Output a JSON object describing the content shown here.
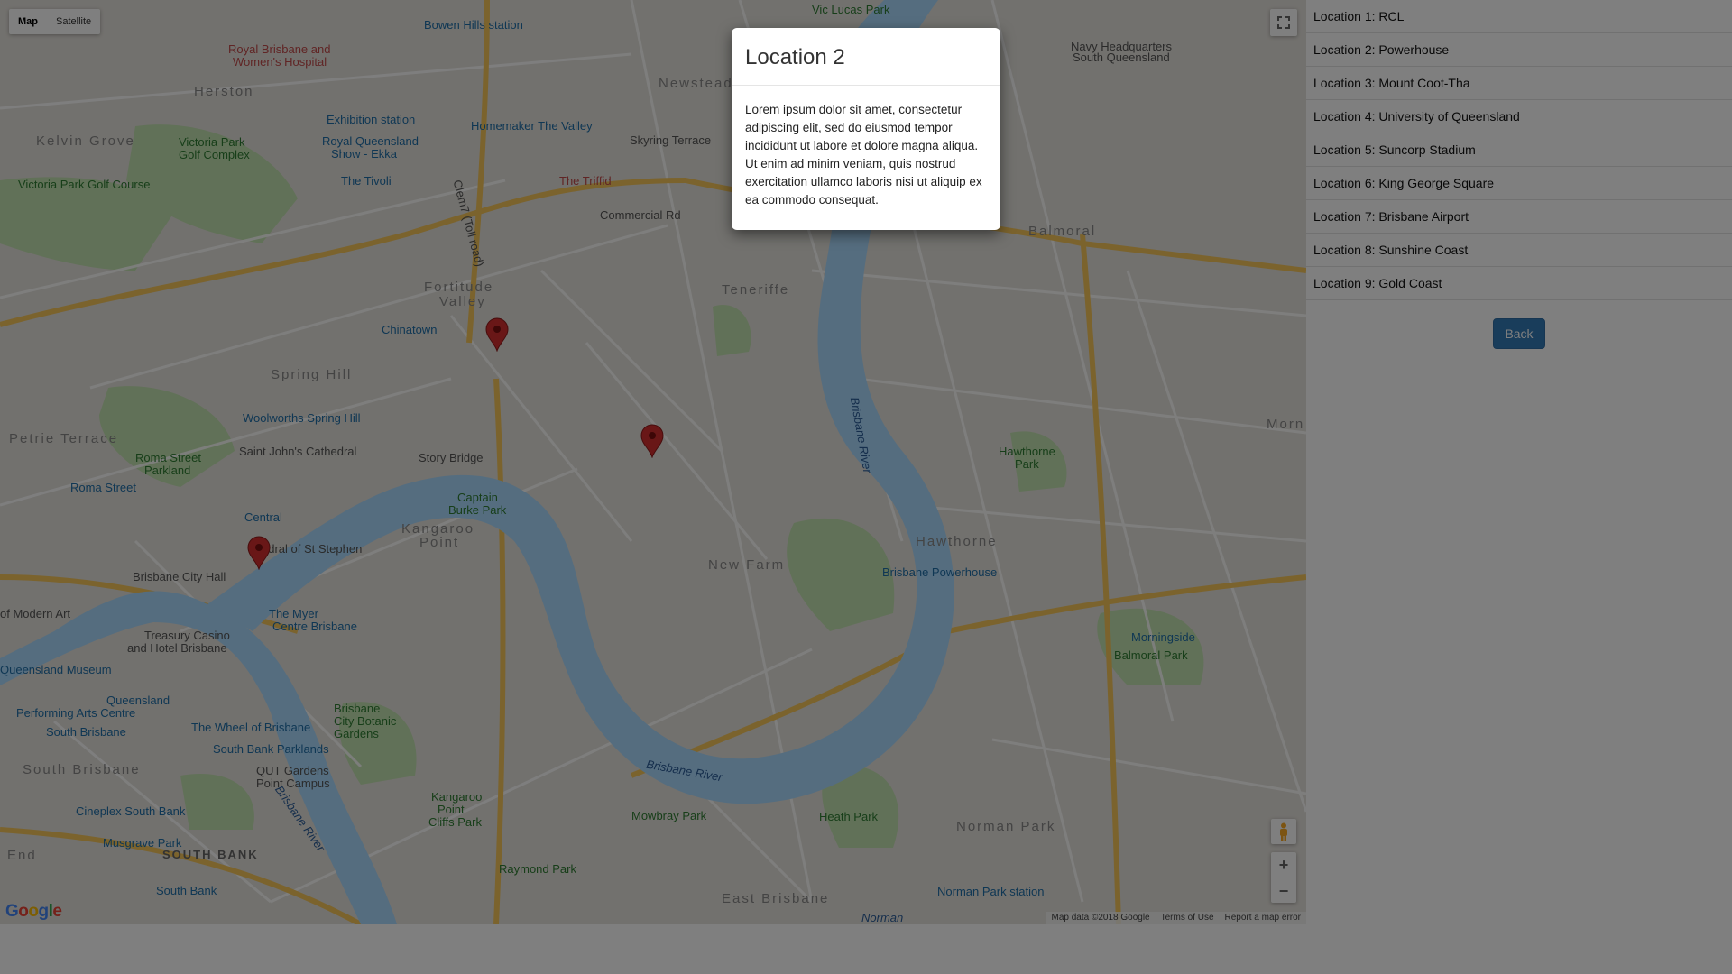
{
  "map": {
    "type_controls": [
      "Map",
      "Satellite"
    ],
    "active_type": "Map",
    "labels": {
      "districts": [
        "Herston",
        "Kelvin Grove",
        "Spring Hill",
        "Fortitude Valley",
        "Newstead",
        "Teneriffe",
        "New Farm",
        "Kangaroo Point",
        "South Brisbane",
        "SOUTH BANK",
        "East Brisbane",
        "Norman Park",
        "Hawthorne",
        "Balmoral",
        "Petrie Terrace",
        "Morn",
        "End"
      ],
      "parks": [
        "Victoria Park Golf Complex",
        "Victoria Park Golf Course",
        "Roma Street Parkland",
        "Captain Burke Park",
        "Brisbane City Botanic Gardens",
        "Kangaroo Point Cliffs Park",
        "Mowbray Park",
        "Raymond Park",
        "Heath Park",
        "Hawthorne Park",
        "Balmoral Park",
        "Vic Lucas Park"
      ],
      "pois": [
        "Bowen Hills station",
        "Royal Brisbane and Women's Hospital",
        "Exhibition station",
        "Royal Queensland Show - Ekka",
        "Homemaker The Valley",
        "The Tivoli",
        "The Triffid",
        "Chinatown",
        "Woolworths Spring Hill",
        "Saint John's Cathedral",
        "Story Bridge",
        "Roma Street",
        "Central",
        "Cathedral of St Stephen",
        "Brisbane City Hall",
        "The Myer Centre Brisbane",
        "Treasury Casino and Hotel Brisbane",
        "Queensland Museum",
        "Queensland Performing Arts Centre",
        "South Brisbane",
        "The Wheel of Brisbane",
        "South Bank Parklands",
        "QUT Gardens Point Campus",
        "Cineplex South Bank",
        "Musgrave Park",
        "South Bank",
        "Brisbane Powerhouse",
        "Morningside",
        "Norman Park station",
        "Navy Headquarters South Queensland",
        "Skyring Terrace",
        "Commercial Rd",
        "Clem7 (Toll road)",
        "of Modern Art"
      ],
      "water": [
        "Brisbane River",
        "Brisbane River",
        "Brisbane River",
        "Norman"
      ]
    },
    "google_logo": "Google",
    "attribution": [
      "Map data ©2018 Google",
      "Terms of Use",
      "Report a map error"
    ],
    "zoom_in": "+",
    "zoom_out": "−"
  },
  "modal": {
    "title": "Location 2",
    "body": "Lorem ipsum dolor sit amet, consectetur adipiscing elit, sed do eiusmod tempor incididunt ut labore et dolore magna aliqua. Ut enim ad minim veniam, quis nostrud exercitation ullamco laboris nisi ut aliquip ex ea commodo consequat."
  },
  "sidebar": {
    "locations": [
      "Location 1: RCL",
      "Location 2: Powerhouse",
      "Location 3: Mount Coot-Tha",
      "Location 4: University of Queensland",
      "Location 5: Suncorp Stadium",
      "Location 6: King George Square",
      "Location 7: Brisbane Airport",
      "Location 8: Sunshine Coast",
      "Location 9: Gold Coast"
    ],
    "back_label": "Back"
  },
  "colors": {
    "river": "#aadaff",
    "park": "#c3e3b0",
    "major_road": "#f6c75b",
    "pin": "#d32f2f",
    "button": "#337ab7"
  }
}
